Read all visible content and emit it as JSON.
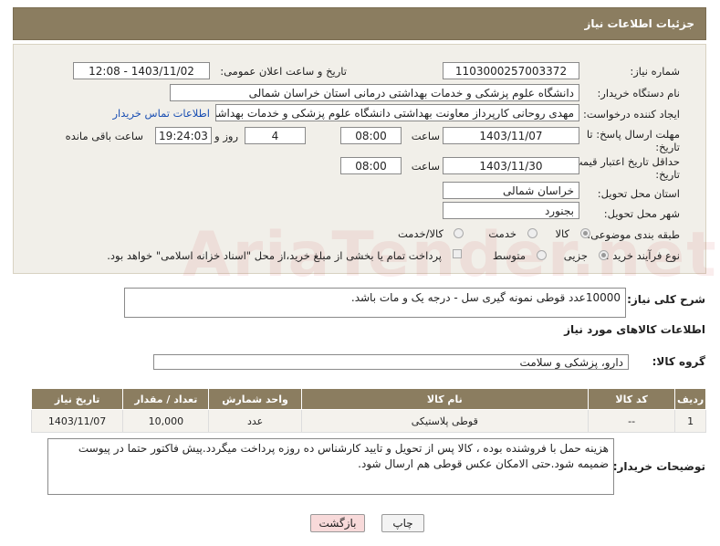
{
  "header": {
    "title": "جزئیات اطلاعات نیاز"
  },
  "form": {
    "need_number": {
      "label": "شماره نیاز:",
      "value": "1103000257003372"
    },
    "announce_date": {
      "label": "تاریخ و ساعت اعلان عمومی:",
      "value": "1403/11/02 - 12:08"
    },
    "buyer_org": {
      "label": "نام دستگاه خریدار:",
      "value": "دانشگاه علوم پزشکی و خدمات بهداشتی درمانی استان خراسان شمالی"
    },
    "requester": {
      "label": "ایجاد کننده درخواست:",
      "value": "مهدی روحانی کارپرداز معاونت بهداشتی دانشگاه علوم پزشکی و خدمات بهداشت",
      "contact_link": "اطلاعات تماس خریدار"
    },
    "deadline": {
      "label_line1": "مهلت ارسال پاسخ: تا",
      "label_line2": "تاریخ:",
      "date": "1403/11/07",
      "time_label": "ساعت",
      "time": "08:00",
      "days": "4",
      "days_label": "روز و",
      "remaining": "19:24:03",
      "remaining_label": "ساعت باقی مانده"
    },
    "validity": {
      "label_line1": "حداقل تاریخ اعتبار قیمت: تا",
      "label_line2": "تاریخ:",
      "date": "1403/11/30",
      "time_label": "ساعت",
      "time": "08:00"
    },
    "province": {
      "label": "استان محل تحویل:",
      "value": "خراسان شمالی"
    },
    "city": {
      "label": "شهر محل تحویل:",
      "value": "بجنورد"
    },
    "category": {
      "label": "طبقه بندی موضوعی:",
      "options": [
        "کالا",
        "خدمت",
        "کالا/خدمت"
      ],
      "selected": "کالا"
    },
    "process": {
      "label": "نوع فرآیند خرید :",
      "options": [
        "جزیی",
        "متوسط"
      ],
      "payment_note": "پرداخت تمام یا بخشی از مبلغ خرید،از محل \"اسناد خزانه اسلامی\" خواهد بود."
    }
  },
  "summary": {
    "label": "شرح کلی نیاز:",
    "value": "10000عدد قوطی نمونه گیری سل - درجه یک و مات باشد."
  },
  "goods_section": {
    "title": "اطلاعات کالاهای مورد نیاز",
    "group_label": "گروه کالا:",
    "group_value": "دارو، پزشکی و سلامت"
  },
  "table": {
    "headers": [
      "ردیف",
      "کد کالا",
      "نام کالا",
      "واحد شمارش",
      "تعداد / مقدار",
      "تاریخ نیاز"
    ],
    "rows": [
      [
        "1",
        "--",
        "قوطی پلاستیکی",
        "عدد",
        "10,000",
        "1403/11/07"
      ]
    ]
  },
  "buyer_notes": {
    "label": "توضیحات خریدار:",
    "value": "هزینه حمل با فروشنده بوده ، کالا پس از تحویل و تایید کارشناس ده روزه پرداخت میگردد.پیش فاکتور حتما در پیوست ضمیمه شود.حتی الامکان عکس قوطی هم ارسال شود."
  },
  "buttons": {
    "print": "چاپ",
    "back": "بازگشت"
  },
  "watermark": "AriaTender.net",
  "colors": {
    "header_bg": "#8b7d60",
    "panel_bg": "#f1efe9",
    "link": "#1a4fb3",
    "back_btn": "#f8dada"
  }
}
